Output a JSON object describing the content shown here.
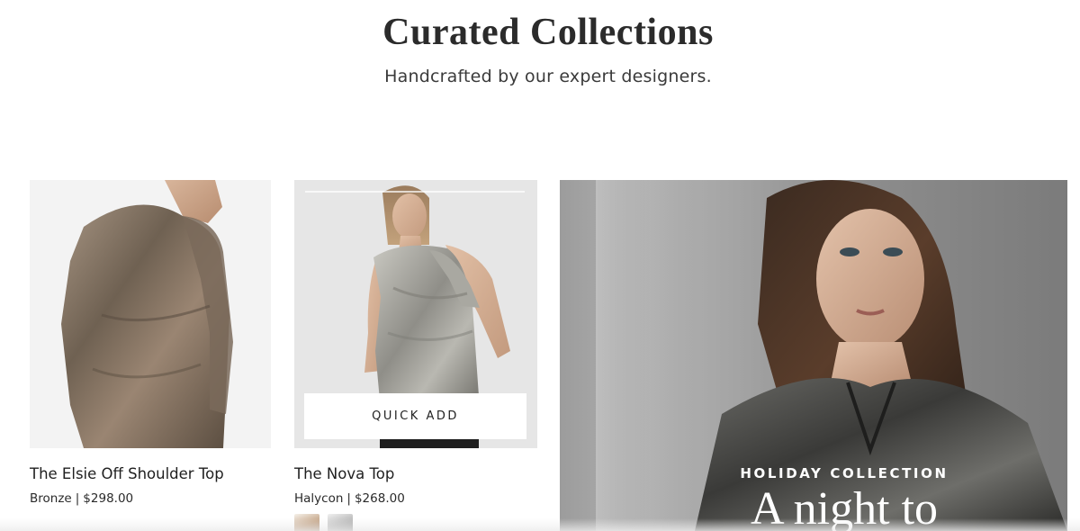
{
  "section": {
    "heading": "Curated Collections",
    "subheading": "Handcrafted by our expert designers."
  },
  "products": [
    {
      "title": "The Elsie Off Shoulder Top",
      "color": "Bronze",
      "separator": "|",
      "price": "$298.00",
      "image_tone": "#8a7665"
    },
    {
      "title": "The Nova Top",
      "color": "Halycon",
      "separator": "|",
      "price": "$268.00",
      "quick_add_label": "QUICK ADD",
      "image_tone": "#a9a9a4",
      "swatches": [
        "bronze",
        "silver"
      ]
    }
  ],
  "feature": {
    "eyebrow": "HOLIDAY COLLECTION",
    "title": "A night to"
  },
  "colors": {
    "text": "#1f1f1f",
    "background": "#ffffff",
    "button_bg": "#ffffff"
  }
}
